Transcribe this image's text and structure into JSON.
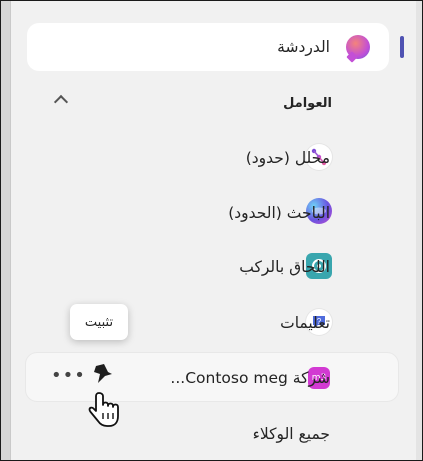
{
  "sidebar": {
    "chat": {
      "label": "الدردشة"
    },
    "agents_header": "العوامل",
    "agents": [
      {
        "label": "محلل (حدود)",
        "icon": "analyst-icon"
      },
      {
        "label": "الباحث (الحدود)",
        "icon": "researcher-icon"
      },
      {
        "label": "اللحاق بالركب",
        "icon": "catch-up-icon"
      },
      {
        "label": "تعليمات",
        "icon": "help-icon"
      },
      {
        "label": "شركة Contoso meg...",
        "icon": "contoso-agent-icon",
        "icon_text": "m3"
      }
    ],
    "tooltip": "تثبيت",
    "more_label": "•••",
    "all_agents": "جميع الوكلاء"
  },
  "colors": {
    "accent": "#4f52b2",
    "contoso": "#d23ad2",
    "catchup": "#39a6ae"
  }
}
